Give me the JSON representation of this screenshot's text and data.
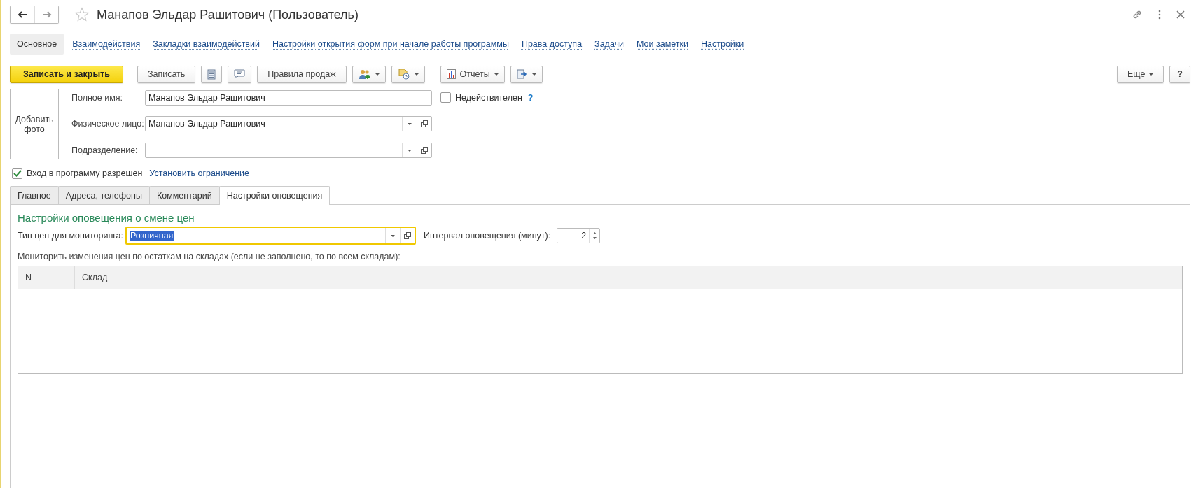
{
  "window": {
    "title": "Манапов Эльдар Рашитович (Пользователь)",
    "favorite": false
  },
  "nav_tabs": [
    {
      "label": "Основное",
      "selected": true
    },
    {
      "label": "Взаимодействия",
      "selected": false
    },
    {
      "label": "Закладки взаимодействий",
      "selected": false
    },
    {
      "label": "Настройки открытия форм при начале работы программы",
      "selected": false
    },
    {
      "label": "Права доступа",
      "selected": false
    },
    {
      "label": "Задачи",
      "selected": false
    },
    {
      "label": "Мои заметки",
      "selected": false
    },
    {
      "label": "Настройки",
      "selected": false
    }
  ],
  "toolbar": [
    {
      "kind": "primary",
      "label": "Записать и закрыть"
    },
    {
      "kind": "button",
      "label": "Записать"
    },
    {
      "kind": "icon"
    },
    {
      "kind": "icon"
    },
    {
      "kind": "button",
      "label": "Правила продаж"
    },
    {
      "kind": "icon-menu"
    },
    {
      "kind": "icon-menu"
    },
    {
      "kind": "icon-menu",
      "label": "Отчеты"
    },
    {
      "kind": "icon-menu"
    }
  ],
  "more_button": "Еще",
  "help_button": "?",
  "photo_button": "Добавить фото",
  "fields": [
    {
      "kind": "text",
      "label": "Полное имя:",
      "value": "Манапов Эльдар Рашитович"
    },
    {
      "kind": "select",
      "label": "Физическое лицо:",
      "value": "Манапов Эльдар Рашитович"
    },
    {
      "kind": "select",
      "label": "Подразделение:"
    }
  ],
  "inactive": {
    "label": "Недействителен",
    "checked": false,
    "help": "?"
  },
  "login": {
    "label": "Вход в программу разрешен",
    "checked": true
  },
  "restriction_link": "Установить ограничение",
  "form_tabs": [
    {
      "label": "Главное",
      "selected": false
    },
    {
      "label": "Адреса, телефоны",
      "selected": false
    },
    {
      "label": "Комментарий",
      "selected": false
    },
    {
      "label": "Настройки оповещения",
      "selected": true
    }
  ],
  "notification": {
    "heading": "Настройки оповещения о смене цен",
    "price_type": {
      "label": "Тип цен для мониторинга:",
      "value": "Розничная",
      "focused": true,
      "text_selected": true
    },
    "interval": {
      "label": "Интервал оповещения (минут):",
      "value": "2"
    },
    "warehouses_note": "Мониторить изменения цен по остаткам на складах (если не заполнено, то по всем складам):",
    "table": {
      "columns": [
        "N",
        "Склад"
      ]
    }
  }
}
